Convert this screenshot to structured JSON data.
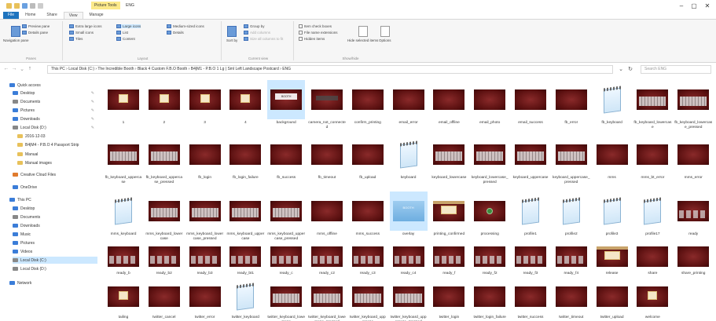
{
  "window": {
    "context_tab": "Picture Tools",
    "title": "ENG",
    "minimize": "–",
    "maximize": "▢",
    "close": "✕"
  },
  "tabs": [
    {
      "label": "File"
    },
    {
      "label": "Home"
    },
    {
      "label": "Share"
    },
    {
      "label": "View"
    },
    {
      "label": "Manage"
    }
  ],
  "ribbon": {
    "panes": {
      "group": "Panes",
      "nav_pane": "Navigation pane",
      "preview": "Preview pane",
      "details": "Details pane"
    },
    "layout": {
      "group": "Layout",
      "items": [
        "Extra large icons",
        "Large icons",
        "Medium-sized icons",
        "Small icons",
        "List",
        "Details",
        "Tiles",
        "Content"
      ]
    },
    "current_view": {
      "group": "Current view",
      "sort": "Sort by",
      "group_by": "Group by",
      "add_columns": "Add columns",
      "size_all": "Size all columns to fit"
    },
    "show_hide": {
      "group": "Show/hide",
      "checkboxes": "Item check boxes",
      "extensions": "File name extensions",
      "hidden": "Hidden items",
      "hide_selected": "Hide selected items",
      "options": "Options"
    }
  },
  "address": {
    "path": "This PC  ›  Local Disk (C:)  ›  The Incredible Booth  ›  Black 4 Custom F.B.O Booth  ›  B4|M1 - P.B.O 1 Lg | Sml Left Landscape Postcard  ›  ENG",
    "search_placeholder": "Search ENG"
  },
  "nav": {
    "items": [
      {
        "label": "Quick access",
        "color": "#3b7dd8"
      },
      {
        "label": "Desktop",
        "color": "#3b7dd8"
      },
      {
        "label": "Documents",
        "color": "#888"
      },
      {
        "label": "Pictures",
        "color": "#3b7dd8"
      },
      {
        "label": "Downloads",
        "color": "#3b7dd8"
      },
      {
        "label": "Local Disk (D:)",
        "color": "#888"
      },
      {
        "label": "2016-12-03",
        "color": "#e8c15a"
      },
      {
        "label": "B4|M4 - P.B.O 4 Passport Strip",
        "color": "#e8c15a"
      },
      {
        "label": "Manual",
        "color": "#e8c15a"
      },
      {
        "label": "Manual images",
        "color": "#e8c15a"
      },
      {
        "label": "Creative Cloud Files",
        "color": "#e07b2e"
      },
      {
        "label": "OneDrive",
        "color": "#3b7dd8"
      },
      {
        "label": "This PC",
        "color": "#3b7dd8"
      },
      {
        "label": "Desktop",
        "color": "#3b7dd8"
      },
      {
        "label": "Documents",
        "color": "#888"
      },
      {
        "label": "Downloads",
        "color": "#3b7dd8"
      },
      {
        "label": "Music",
        "color": "#3b7dd8"
      },
      {
        "label": "Pictures",
        "color": "#3b7dd8"
      },
      {
        "label": "Videos",
        "color": "#3b7dd8"
      },
      {
        "label": "Local Disk (C:)",
        "color": "#888"
      },
      {
        "label": "Local Disk (D:)",
        "color": "#888"
      },
      {
        "label": "Network",
        "color": "#3b7dd8"
      }
    ]
  },
  "files": [
    {
      "name": "1",
      "kind": "panel"
    },
    {
      "name": "2",
      "kind": "panel"
    },
    {
      "name": "3",
      "kind": "panel"
    },
    {
      "name": "4",
      "kind": "panel"
    },
    {
      "name": "background",
      "kind": "title",
      "text": "BOOTH"
    },
    {
      "name": "camera_not_connected",
      "kind": "bar"
    },
    {
      "name": "confirm_printing",
      "kind": "plain"
    },
    {
      "name": "email_error",
      "kind": "plain"
    },
    {
      "name": "email_offline",
      "kind": "plain"
    },
    {
      "name": "email_photo",
      "kind": "plain"
    },
    {
      "name": "email_success",
      "kind": "plain"
    },
    {
      "name": "fb_error",
      "kind": "plain"
    },
    {
      "name": "fb_keyboard",
      "kind": "notepad"
    },
    {
      "name": "fb_keyboard_lowercase",
      "kind": "keys"
    },
    {
      "name": "fb_keyboard_lowercase_pressed",
      "kind": "keys"
    },
    {
      "name": "fb_keyboard_uppercase",
      "kind": "keys"
    },
    {
      "name": "fb_keyboard_uppercase_pressed",
      "kind": "keys"
    },
    {
      "name": "fb_login",
      "kind": "plain"
    },
    {
      "name": "fb_login_failure",
      "kind": "plain"
    },
    {
      "name": "fb_success",
      "kind": "plain"
    },
    {
      "name": "fb_timeout",
      "kind": "plain"
    },
    {
      "name": "fb_upload",
      "kind": "plain"
    },
    {
      "name": "keyboard",
      "kind": "notepad"
    },
    {
      "name": "keyboard_lowercase",
      "kind": "keys"
    },
    {
      "name": "keyboard_lowercase_pressed",
      "kind": "keys"
    },
    {
      "name": "keyboard_uppercase",
      "kind": "keys"
    },
    {
      "name": "keyboard_uppercase_pressed",
      "kind": "keys"
    },
    {
      "name": "mms",
      "kind": "plain"
    },
    {
      "name": "mms_bt_error",
      "kind": "plain"
    },
    {
      "name": "mms_error",
      "kind": "plain"
    },
    {
      "name": "mms_keyboard",
      "kind": "notepad"
    },
    {
      "name": "mms_keyboard_lowercase",
      "kind": "keys"
    },
    {
      "name": "mms_keyboard_lowercase_pressed",
      "kind": "keys"
    },
    {
      "name": "mms_keyboard_uppercase",
      "kind": "keys"
    },
    {
      "name": "mms_keyboard_uppercase_pressed",
      "kind": "keys"
    },
    {
      "name": "mms_offline",
      "kind": "plain"
    },
    {
      "name": "mms_success",
      "kind": "plain"
    },
    {
      "name": "overlay",
      "kind": "blue",
      "text": "BOOTH"
    },
    {
      "name": "printing_confirmed",
      "kind": "band"
    },
    {
      "name": "processing",
      "kind": "circle"
    },
    {
      "name": "profile1",
      "kind": "notepad"
    },
    {
      "name": "profile2",
      "kind": "notepad"
    },
    {
      "name": "profile3",
      "kind": "notepad"
    },
    {
      "name": "profile17",
      "kind": "notepad"
    },
    {
      "name": "ready",
      "kind": "dots"
    },
    {
      "name": "ready_b",
      "kind": "dots"
    },
    {
      "name": "ready_b2",
      "kind": "dots"
    },
    {
      "name": "ready_b3",
      "kind": "dots"
    },
    {
      "name": "ready_bt1",
      "kind": "dots"
    },
    {
      "name": "ready_c",
      "kind": "dots"
    },
    {
      "name": "ready_c2",
      "kind": "dots"
    },
    {
      "name": "ready_c3",
      "kind": "dots"
    },
    {
      "name": "ready_c4",
      "kind": "dots"
    },
    {
      "name": "ready_f",
      "kind": "dots"
    },
    {
      "name": "ready_f2",
      "kind": "dots"
    },
    {
      "name": "ready_f3",
      "kind": "dots"
    },
    {
      "name": "ready_f4",
      "kind": "dots"
    },
    {
      "name": "release",
      "kind": "band"
    },
    {
      "name": "share",
      "kind": "plain"
    },
    {
      "name": "share_printing",
      "kind": "plain"
    },
    {
      "name": "tailing",
      "kind": "panel"
    },
    {
      "name": "twitter_cancel",
      "kind": "plain"
    },
    {
      "name": "twitter_error",
      "kind": "plain"
    },
    {
      "name": "twitter_keyboard",
      "kind": "notepad"
    },
    {
      "name": "twitter_keyboard_lowercase",
      "kind": "keys"
    },
    {
      "name": "twitter_keyboard_lowercase_pressed",
      "kind": "keys"
    },
    {
      "name": "twitter_keyboard_uppercase",
      "kind": "keys"
    },
    {
      "name": "twitter_keyboard_uppercase_pressed",
      "kind": "keys"
    },
    {
      "name": "twitter_login",
      "kind": "plain"
    },
    {
      "name": "twitter_login_failure",
      "kind": "plain"
    },
    {
      "name": "twitter_success",
      "kind": "plain"
    },
    {
      "name": "twitter_timeout",
      "kind": "plain"
    },
    {
      "name": "twitter_upload",
      "kind": "plain"
    },
    {
      "name": "welcome",
      "kind": "panel"
    }
  ],
  "selected": [
    "background",
    "overlay"
  ]
}
